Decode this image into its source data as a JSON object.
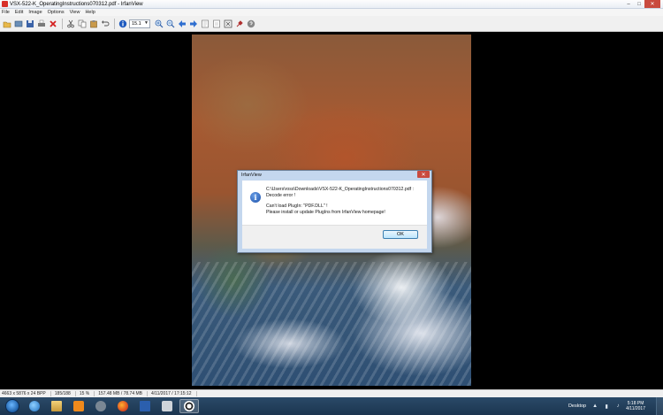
{
  "window": {
    "title": "VSX-522-K_OperatingInstructions070312.pdf - IrfanView",
    "min_glyph": "–",
    "max_glyph": "□",
    "close_glyph": "✕"
  },
  "menu": [
    "File",
    "Edit",
    "Image",
    "Options",
    "View",
    "Help"
  ],
  "toolbar": {
    "zoom_value": "15.1",
    "icons": [
      "open-icon",
      "slideshow-icon",
      "save-icon",
      "print-icon",
      "delete-icon",
      "cut-icon",
      "copy-icon",
      "paste-icon",
      "undo-icon",
      "info-icon",
      "zoom-in-icon",
      "zoom-out-icon",
      "prev-icon",
      "next-icon",
      "page-first-icon",
      "page-last-icon",
      "fit-icon",
      "settings-icon",
      "help-icon"
    ]
  },
  "dialog": {
    "title": "IrfanView",
    "close_glyph": "✕",
    "line1": "C:\\Users\\ross\\Downloads\\VSX-522-K_OperatingInstructions070312.pdf :",
    "line2": "Decode error !",
    "line3": "Can't load PlugIn: \"PDF.DLL\" !",
    "line4": "Please install or update PlugIns from IrfanView homepage!",
    "ok_label": "OK",
    "info_glyph": "i"
  },
  "status": {
    "dimensions": "4663 x 5876 x 24 BPP",
    "page": "185/188",
    "zoom": "15 %",
    "memory": "157.48 MB / 78.74 MB",
    "datetime": "4/11/2017 / 17:15:12"
  },
  "taskbar": {
    "tray_label": "Desktop",
    "time": "5:18 PM",
    "date": "4/11/2017",
    "apps": [
      "ie-icon",
      "explorer-icon",
      "media-player-icon",
      "skype-icon",
      "firefox-icon",
      "word-icon",
      "camera-icon",
      "irfanview-icon"
    ]
  }
}
